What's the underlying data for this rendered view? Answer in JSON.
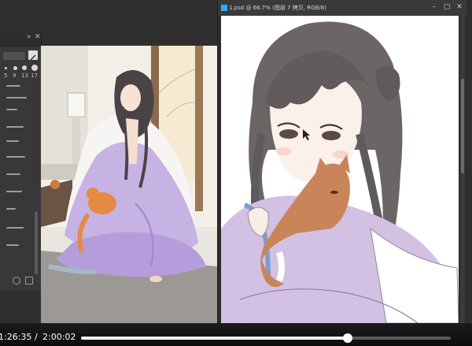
{
  "document_window": {
    "title": "1.psd @ 66.7% (图层 7 拷贝, RGB/8)",
    "zoom": "66.7%"
  },
  "brush_panel": {
    "brush_sizes": [
      "5",
      "9",
      "13",
      "17"
    ]
  },
  "video_player": {
    "current_time": "1:26:35",
    "separator": "/",
    "duration": "2:00:02",
    "progress_fraction": 0.7212
  }
}
